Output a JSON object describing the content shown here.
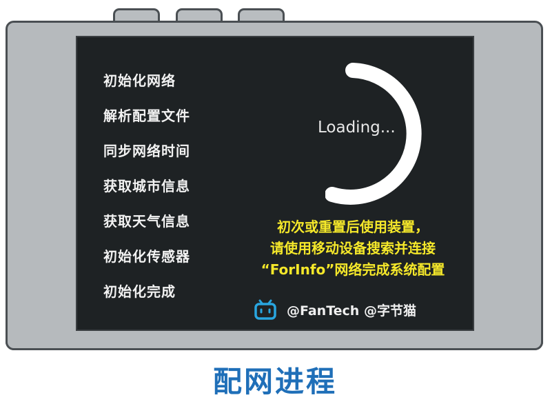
{
  "device": {
    "screen": {
      "init_steps": [
        "初始化网络",
        "解析配置文件",
        "同步网络时间",
        "获取城市信息",
        "获取天气信息",
        "初始化传感器",
        "初始化完成"
      ],
      "loading_text": "Loading...",
      "notice_lines": [
        "初次或重置后使用装置，",
        "请使用移动设备搜索并连接",
        "“ForInfo”网络完成系统配置"
      ],
      "credit_icon": "bilibili-tv-icon",
      "credit_text": "@FanTech @字节猫"
    }
  },
  "caption": "配网进程",
  "colors": {
    "screen_bg": "#1e2224",
    "notice": "#f5e82a",
    "caption": "#1f6fb8",
    "credit_icon": "#29a6e0",
    "device_body": "#b6babd"
  }
}
